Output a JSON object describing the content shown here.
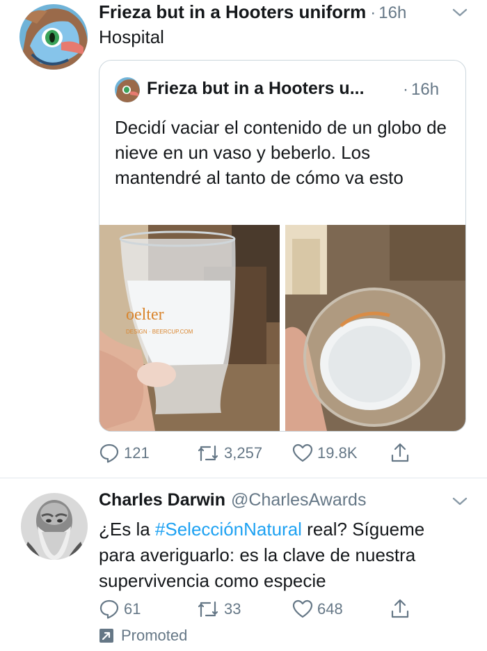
{
  "tweet1": {
    "author_name": "Frieza but in a Hooters uniform",
    "separator": "·",
    "time": "16h",
    "text": "Hospital",
    "quoted": {
      "author_name": "Frieza but in a Hooters u...",
      "separator": "·",
      "time": "16h",
      "text": "Decidí vaciar el contenido de un globo de nieve en un vaso y beberlo. Los mantendré al tanto de cómo va esto",
      "glass_print_1": "oelter",
      "glass_print_2": "DESIGN · BEERCUP.COM"
    },
    "actions": {
      "replies": "121",
      "retweets": "3,257",
      "likes": "19.8K"
    }
  },
  "tweet2": {
    "author_name": "Charles Darwin",
    "handle": "@CharlesAwards",
    "text_before": "¿Es la ",
    "hashtag": "#SelecciónNatural",
    "text_after": " real? Sígueme para averiguarlo: es la clave de nuestra supervivencia como especie",
    "actions": {
      "replies": "61",
      "retweets": "33",
      "likes": "648"
    },
    "promoted_label": "Promoted"
  },
  "colors": {
    "link": "#1da1f2",
    "muted": "#657786",
    "text": "#14171a",
    "border": "#ccd6dd"
  },
  "icons": [
    "chevron-down-icon",
    "reply-icon",
    "retweet-icon",
    "like-icon",
    "share-icon",
    "promoted-icon"
  ]
}
